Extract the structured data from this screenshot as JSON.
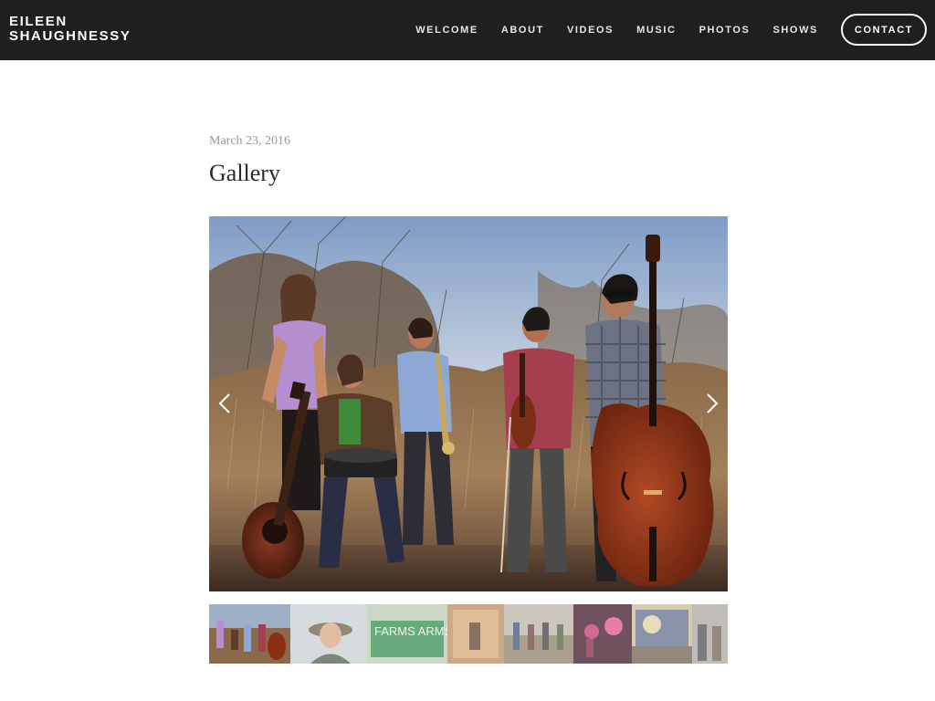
{
  "site": {
    "name_line1": "EILEEN",
    "name_line2": "SHAUGHNESSY"
  },
  "nav": {
    "items": [
      {
        "label": "WELCOME"
      },
      {
        "label": "ABOUT"
      },
      {
        "label": "VIDEOS"
      },
      {
        "label": "MUSIC"
      },
      {
        "label": "PHOTOS"
      },
      {
        "label": "SHOWS"
      }
    ],
    "contact_label": "CONTACT"
  },
  "post": {
    "date": "March 23, 2016",
    "title": "Gallery"
  },
  "gallery": {
    "prev_icon": "chevron-left-icon",
    "next_icon": "chevron-right-icon",
    "thumbnail_count": 9,
    "thumbnail_text": "FARMS ARMS"
  },
  "colors": {
    "header_bg": "#1f1f1f",
    "accent": "#ffffff",
    "date_text": "#9a9a9a",
    "title_text": "#2a2a2a"
  }
}
